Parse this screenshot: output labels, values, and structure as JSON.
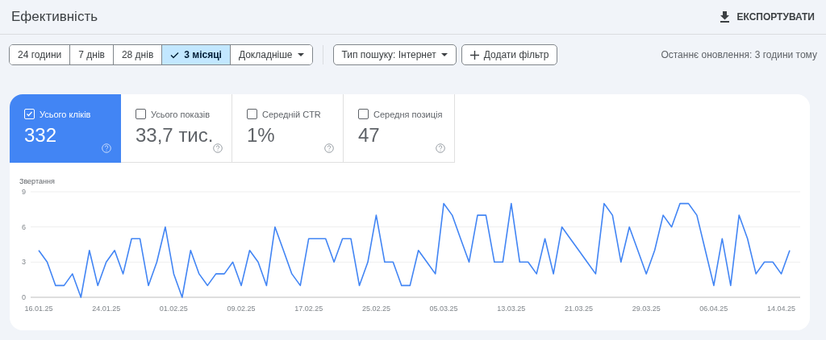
{
  "header": {
    "title": "Ефективність",
    "export_button": "ЕКСПОРТУВАТИ"
  },
  "date_ranges": [
    {
      "label": "24 години",
      "selected": false
    },
    {
      "label": "7 днів",
      "selected": false
    },
    {
      "label": "28 днів",
      "selected": false
    },
    {
      "label": "3 місяці",
      "selected": true
    },
    {
      "label": "Докладніше",
      "selected": false,
      "kind": "dropdown"
    }
  ],
  "search_type_button": "Тип пошуку: Інтернет",
  "add_filter_button": "Додати фільтр",
  "last_update": "Останнє оновлення: 3 години тому",
  "metrics": [
    {
      "label": "Усього кліків",
      "value": "332",
      "checked": true
    },
    {
      "label": "Усього показів",
      "value": "33,7 тис.",
      "checked": false
    },
    {
      "label": "Середній CTR",
      "value": "1%",
      "checked": false
    },
    {
      "label": "Середня позиція",
      "value": "47",
      "checked": false
    }
  ],
  "chart": {
    "chart_data": {
      "type": "line",
      "ylabel": "Звертання",
      "ylim": [
        0,
        9
      ],
      "yticks": [
        0,
        3,
        6,
        9
      ],
      "categories": [
        "16.01.25",
        null,
        null,
        null,
        null,
        null,
        null,
        null,
        "24.01.25",
        null,
        null,
        null,
        null,
        null,
        null,
        null,
        "01.02.25",
        null,
        null,
        null,
        null,
        null,
        null,
        null,
        "09.02.25",
        null,
        null,
        null,
        null,
        null,
        null,
        null,
        "17.02.25",
        null,
        null,
        null,
        null,
        null,
        null,
        null,
        "25.02.25",
        null,
        null,
        null,
        null,
        null,
        null,
        null,
        "05.03.25",
        null,
        null,
        null,
        null,
        null,
        null,
        null,
        "13.03.25",
        null,
        null,
        null,
        null,
        null,
        null,
        null,
        "21.03.25",
        null,
        null,
        null,
        null,
        null,
        null,
        null,
        "29.03.25",
        null,
        null,
        null,
        null,
        null,
        null,
        null,
        "06.04.25",
        null,
        null,
        null,
        null,
        null,
        null,
        null,
        "14.04.25",
        null
      ],
      "series": [
        {
          "color": "#4285f4",
          "values": [
            4,
            3,
            1,
            1,
            2,
            0,
            4,
            1,
            3,
            4,
            2,
            5,
            5,
            1,
            3,
            6,
            2,
            0,
            4,
            2,
            1,
            2,
            2,
            3,
            1,
            4,
            3,
            1,
            6,
            4,
            2,
            1,
            5,
            5,
            5,
            3,
            5,
            5,
            1,
            3,
            7,
            3,
            3,
            1,
            1,
            4,
            3,
            2,
            8,
            7,
            5,
            3,
            7,
            7,
            3,
            3,
            8,
            3,
            3,
            2,
            5,
            2,
            6,
            5,
            4,
            3,
            2,
            8,
            7,
            3,
            6,
            4,
            2,
            4,
            7,
            6,
            8,
            8,
            7,
            4,
            1,
            5,
            1,
            7,
            5,
            2,
            3,
            3,
            2,
            4
          ]
        }
      ]
    }
  }
}
